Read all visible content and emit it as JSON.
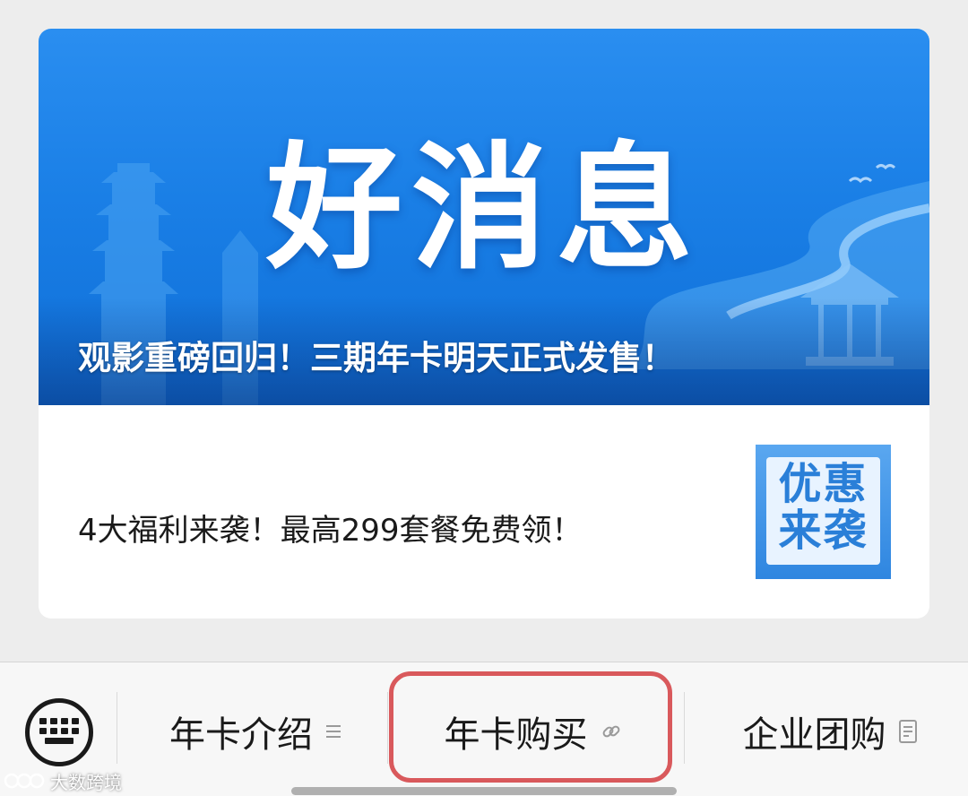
{
  "article_feature": {
    "banner_headline": "好消息",
    "title": "观影重磅回归！三期年卡明天正式发售！"
  },
  "article_secondary": {
    "title": "4大福利来袭！最高299套餐免费领！",
    "thumbnail_text": "优惠来袭"
  },
  "menu": {
    "items": [
      {
        "label": "年卡介绍",
        "icon": "list-lines-icon"
      },
      {
        "label": "年卡购买",
        "icon": "link-icon"
      },
      {
        "label": "企业团购",
        "icon": "document-icon"
      }
    ]
  },
  "watermark": {
    "text": "大数跨境"
  },
  "colors": {
    "banner_blue": "#1a7fe6",
    "highlight_red": "#d9595c",
    "menubar_bg": "#f7f7f7"
  }
}
